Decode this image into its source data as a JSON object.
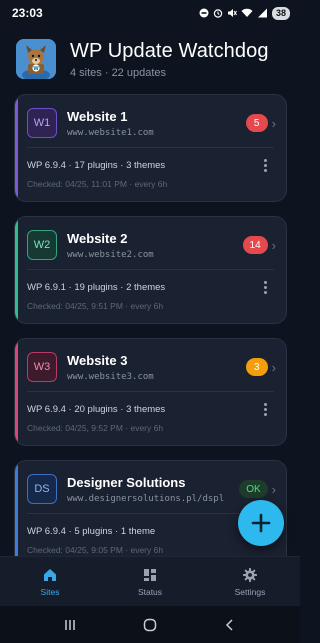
{
  "status_bar": {
    "time": "23:03",
    "battery": "38"
  },
  "header": {
    "title": "WP Update Watchdog",
    "subtitle": "4 sites · 22 updates"
  },
  "sites": [
    {
      "initials": "W1",
      "name": "Website 1",
      "url": "www.website1.com",
      "badge": "5",
      "badge_color": "#e5484d",
      "accent": "#7c5cd6",
      "avatar_bg": "#2f2353",
      "avatar_border": "#6d4fc8",
      "avatar_text": "#b9a6f3",
      "meta": "WP 6.9.4  ·  17 plugins  ·  3 themes",
      "checked": "Checked: 04/25, 11:01 PM · every 6h"
    },
    {
      "initials": "W2",
      "name": "Website 2",
      "url": "www.website2.com",
      "badge": "14",
      "badge_color": "#e5484d",
      "accent": "#2fbf8f",
      "avatar_bg": "#163a33",
      "avatar_border": "#2fa47e",
      "avatar_text": "#7fe0bf",
      "meta": "WP 6.9.1  ·  19 plugins  ·  2 themes",
      "checked": "Checked: 04/25, 9:51 PM · every 6h"
    },
    {
      "initials": "W3",
      "name": "Website 3",
      "url": "www.website3.com",
      "badge": "3",
      "badge_color": "#f59e0b",
      "accent": "#d9477a",
      "avatar_bg": "#3d1a2c",
      "avatar_border": "#b83a66",
      "avatar_text": "#f08bb0",
      "meta": "WP 6.9.4  ·  20 plugins  ·  3 themes",
      "checked": "Checked: 04/25, 9:52 PM · every 6h"
    },
    {
      "initials": "DS",
      "name": "Designer Solutions",
      "url": "www.designersolutions.pl/dspl",
      "badge": "OK",
      "badge_color": "#1f3b2c",
      "badge_text": "#4ade80",
      "accent": "#3b7dd8",
      "avatar_bg": "#17294a",
      "avatar_border": "#3a6fc4",
      "avatar_text": "#8fb6f2",
      "meta": "WP 6.9.4  ·  5 plugins  ·  1 theme",
      "checked": "Checked: 04/25, 9:05 PM · every 6h"
    }
  ],
  "bottom_nav": {
    "sites": "Sites",
    "status": "Status",
    "settings": "Settings"
  },
  "colors": {
    "accent": "#3aa7e8",
    "fab": "#2db8ee"
  }
}
